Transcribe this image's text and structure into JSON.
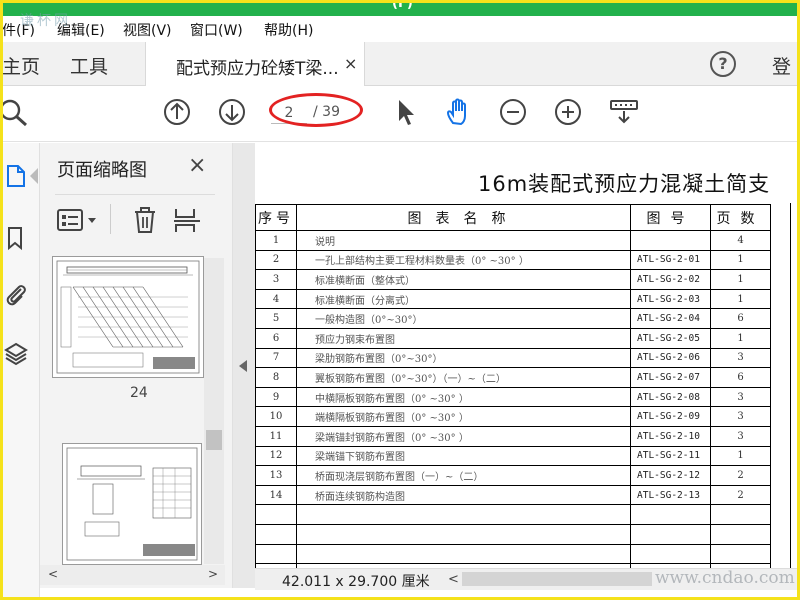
{
  "window": {
    "title_fragment": "(F)"
  },
  "watermark": {
    "top_left": "谦杯网",
    "bottom_right": "www.cndao.com"
  },
  "menu": [
    "件(F)",
    "编辑(E)",
    "视图(V)",
    "窗口(W)",
    "帮助(H)"
  ],
  "tabs": {
    "home": "主页",
    "tools": "工具",
    "document": "配式预应力砼矮T梁...",
    "close": "×"
  },
  "header": {
    "help": "?",
    "login": "登"
  },
  "toolbar": {
    "page_current": "2",
    "page_total": "/ 39"
  },
  "thumbnails": {
    "title": "页面缩略图",
    "close": "×",
    "page_label": "24"
  },
  "document": {
    "title": "16m装配式预应力混凝土简支",
    "headers": [
      "序号",
      "图表名称",
      "图号",
      "页数"
    ],
    "rows": [
      [
        "1",
        "说明",
        "",
        "4"
      ],
      [
        "2",
        "一孔上部结构主要工程材料数量表（0° ~30° ）",
        "ATL-SG-2-01",
        "1"
      ],
      [
        "3",
        "标准横断面（整体式）",
        "ATL-SG-2-02",
        "1"
      ],
      [
        "4",
        "标准横断面（分离式）",
        "ATL-SG-2-03",
        "1"
      ],
      [
        "5",
        "一般构造图（0°~30°）",
        "ATL-SG-2-04",
        "6"
      ],
      [
        "6",
        "预应力钢束布置图",
        "ATL-SG-2-05",
        "1"
      ],
      [
        "7",
        "梁肋钢筋布置图（0°~30°）",
        "ATL-SG-2-06",
        "3"
      ],
      [
        "8",
        "翼板钢筋布置图（0°~30°）（一）~（二）",
        "ATL-SG-2-07",
        "6"
      ],
      [
        "9",
        "中横隔板钢筋布置图（0° ~30° ）",
        "ATL-SG-2-08",
        "3"
      ],
      [
        "10",
        "端横隔板钢筋布置图（0° ~30° ）",
        "ATL-SG-2-09",
        "3"
      ],
      [
        "11",
        "梁端锚封钢筋布置图（0° ~30° ）",
        "ATL-SG-2-10",
        "3"
      ],
      [
        "12",
        "梁端锚下钢筋布置图",
        "ATL-SG-2-11",
        "1"
      ],
      [
        "13",
        "桥面现浇层钢筋布置图（一）~（二）",
        "ATL-SG-2-12",
        "2"
      ],
      [
        "14",
        "桥面连续钢筋构造图",
        "ATL-SG-2-13",
        "2"
      ]
    ],
    "empty_rows": 4
  },
  "status": {
    "paper_size": "42.011 x 29.700 厘米"
  },
  "colors": {
    "accent_green": "#22b14c",
    "frame_yellow": "#f5e21b",
    "annotation_red": "#e32222",
    "icon_blue": "#1473e6"
  }
}
